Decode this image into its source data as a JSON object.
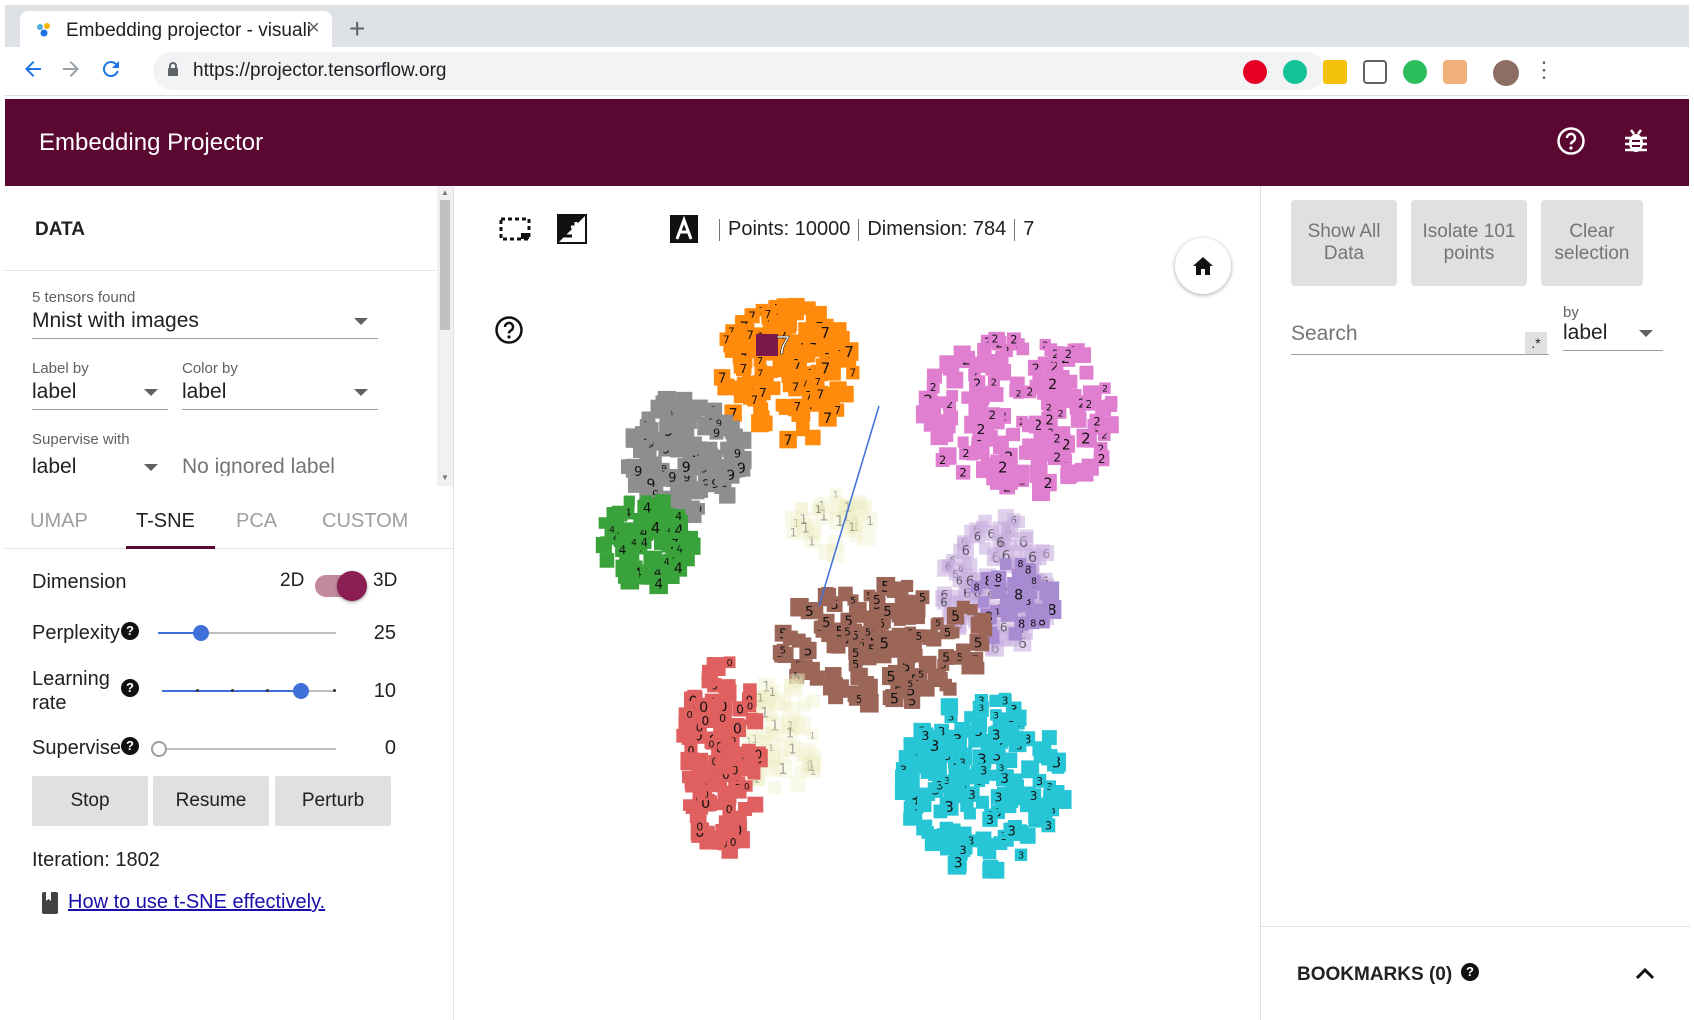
{
  "browser": {
    "tab_title": "Embedding projector - visualization of high-dimensional data",
    "new_tab": "+",
    "close": "×",
    "url": "https://projector.tensorflow.org"
  },
  "app": {
    "title": "Embedding Projector"
  },
  "data_panel": {
    "title": "DATA",
    "tensors_found": "5 tensors found",
    "tensor_value": "Mnist with images",
    "label_by_label": "Label by",
    "label_by_value": "label",
    "color_by_label": "Color by",
    "color_by_value": "label",
    "supervise_with_label": "Supervise with",
    "supervise_with_value": "label",
    "ignored_label": "No ignored label"
  },
  "tabs": [
    "UMAP",
    "T-SNE",
    "PCA",
    "CUSTOM"
  ],
  "tsne": {
    "dimension_label": "Dimension",
    "dim_2d": "2D",
    "dim_3d": "3D",
    "perplexity_label": "Perplexity",
    "perplexity_value": "25",
    "perplexity_fraction": 0.24,
    "learning_rate_label_1": "Learning",
    "learning_rate_label_2": "rate",
    "learning_rate_value": "10",
    "learning_rate_fraction": 0.8,
    "supervise_label": "Supervise",
    "supervise_value": "0",
    "supervise_fraction": 0.0,
    "stop": "Stop",
    "resume": "Resume",
    "perturb": "Perturb",
    "iteration": "Iteration: 1802",
    "link": "How to use t-SNE effectively."
  },
  "center": {
    "points": "Points: 10000",
    "dimension": "Dimension: 784",
    "selected": "7",
    "hover_label": "7"
  },
  "right_panel": {
    "show_all": "Show All Data",
    "isolate": "Isolate 101 points",
    "clear": "Clear selection",
    "search_placeholder": "Search",
    "regex": ".*",
    "by": "by",
    "by_value": "label",
    "bookmarks": "BOOKMARKS (0)"
  },
  "clusters": [
    {
      "digit": "0",
      "color": "#e06060"
    },
    {
      "digit": "1",
      "color": "#eeeec4"
    },
    {
      "digit": "2",
      "color": "#e07ed0"
    },
    {
      "digit": "3",
      "color": "#27c6d6"
    },
    {
      "digit": "4",
      "color": "#3aa23a"
    },
    {
      "digit": "5",
      "color": "#9b6658"
    },
    {
      "digit": "6",
      "color": "#c9b0e0"
    },
    {
      "digit": "7",
      "color": "#ff8a0c"
    },
    {
      "digit": "8",
      "color": "#a98bd2"
    },
    {
      "digit": "9",
      "color": "#8e8e8e"
    }
  ]
}
